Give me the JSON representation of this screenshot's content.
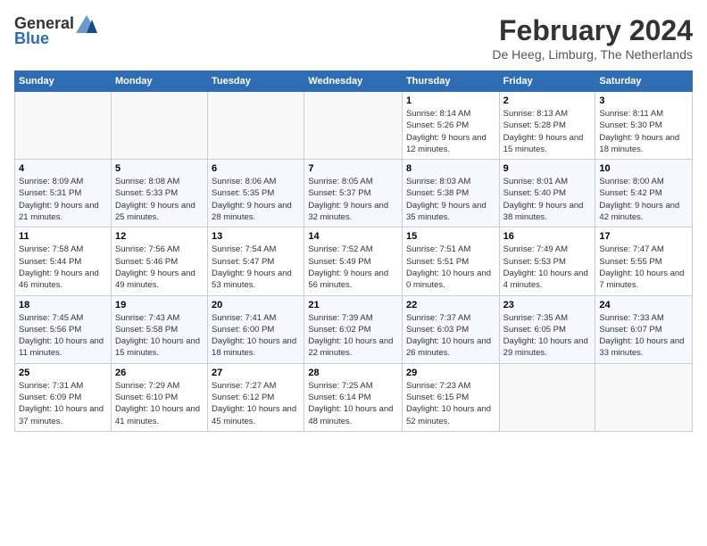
{
  "header": {
    "logo_general": "General",
    "logo_blue": "Blue",
    "month_year": "February 2024",
    "location": "De Heeg, Limburg, The Netherlands"
  },
  "calendar": {
    "days_of_week": [
      "Sunday",
      "Monday",
      "Tuesday",
      "Wednesday",
      "Thursday",
      "Friday",
      "Saturday"
    ],
    "weeks": [
      [
        {
          "day": "",
          "info": ""
        },
        {
          "day": "",
          "info": ""
        },
        {
          "day": "",
          "info": ""
        },
        {
          "day": "",
          "info": ""
        },
        {
          "day": "1",
          "info": "Sunrise: 8:14 AM\nSunset: 5:26 PM\nDaylight: 9 hours and 12 minutes."
        },
        {
          "day": "2",
          "info": "Sunrise: 8:13 AM\nSunset: 5:28 PM\nDaylight: 9 hours and 15 minutes."
        },
        {
          "day": "3",
          "info": "Sunrise: 8:11 AM\nSunset: 5:30 PM\nDaylight: 9 hours and 18 minutes."
        }
      ],
      [
        {
          "day": "4",
          "info": "Sunrise: 8:09 AM\nSunset: 5:31 PM\nDaylight: 9 hours and 21 minutes."
        },
        {
          "day": "5",
          "info": "Sunrise: 8:08 AM\nSunset: 5:33 PM\nDaylight: 9 hours and 25 minutes."
        },
        {
          "day": "6",
          "info": "Sunrise: 8:06 AM\nSunset: 5:35 PM\nDaylight: 9 hours and 28 minutes."
        },
        {
          "day": "7",
          "info": "Sunrise: 8:05 AM\nSunset: 5:37 PM\nDaylight: 9 hours and 32 minutes."
        },
        {
          "day": "8",
          "info": "Sunrise: 8:03 AM\nSunset: 5:38 PM\nDaylight: 9 hours and 35 minutes."
        },
        {
          "day": "9",
          "info": "Sunrise: 8:01 AM\nSunset: 5:40 PM\nDaylight: 9 hours and 38 minutes."
        },
        {
          "day": "10",
          "info": "Sunrise: 8:00 AM\nSunset: 5:42 PM\nDaylight: 9 hours and 42 minutes."
        }
      ],
      [
        {
          "day": "11",
          "info": "Sunrise: 7:58 AM\nSunset: 5:44 PM\nDaylight: 9 hours and 46 minutes."
        },
        {
          "day": "12",
          "info": "Sunrise: 7:56 AM\nSunset: 5:46 PM\nDaylight: 9 hours and 49 minutes."
        },
        {
          "day": "13",
          "info": "Sunrise: 7:54 AM\nSunset: 5:47 PM\nDaylight: 9 hours and 53 minutes."
        },
        {
          "day": "14",
          "info": "Sunrise: 7:52 AM\nSunset: 5:49 PM\nDaylight: 9 hours and 56 minutes."
        },
        {
          "day": "15",
          "info": "Sunrise: 7:51 AM\nSunset: 5:51 PM\nDaylight: 10 hours and 0 minutes."
        },
        {
          "day": "16",
          "info": "Sunrise: 7:49 AM\nSunset: 5:53 PM\nDaylight: 10 hours and 4 minutes."
        },
        {
          "day": "17",
          "info": "Sunrise: 7:47 AM\nSunset: 5:55 PM\nDaylight: 10 hours and 7 minutes."
        }
      ],
      [
        {
          "day": "18",
          "info": "Sunrise: 7:45 AM\nSunset: 5:56 PM\nDaylight: 10 hours and 11 minutes."
        },
        {
          "day": "19",
          "info": "Sunrise: 7:43 AM\nSunset: 5:58 PM\nDaylight: 10 hours and 15 minutes."
        },
        {
          "day": "20",
          "info": "Sunrise: 7:41 AM\nSunset: 6:00 PM\nDaylight: 10 hours and 18 minutes."
        },
        {
          "day": "21",
          "info": "Sunrise: 7:39 AM\nSunset: 6:02 PM\nDaylight: 10 hours and 22 minutes."
        },
        {
          "day": "22",
          "info": "Sunrise: 7:37 AM\nSunset: 6:03 PM\nDaylight: 10 hours and 26 minutes."
        },
        {
          "day": "23",
          "info": "Sunrise: 7:35 AM\nSunset: 6:05 PM\nDaylight: 10 hours and 29 minutes."
        },
        {
          "day": "24",
          "info": "Sunrise: 7:33 AM\nSunset: 6:07 PM\nDaylight: 10 hours and 33 minutes."
        }
      ],
      [
        {
          "day": "25",
          "info": "Sunrise: 7:31 AM\nSunset: 6:09 PM\nDaylight: 10 hours and 37 minutes."
        },
        {
          "day": "26",
          "info": "Sunrise: 7:29 AM\nSunset: 6:10 PM\nDaylight: 10 hours and 41 minutes."
        },
        {
          "day": "27",
          "info": "Sunrise: 7:27 AM\nSunset: 6:12 PM\nDaylight: 10 hours and 45 minutes."
        },
        {
          "day": "28",
          "info": "Sunrise: 7:25 AM\nSunset: 6:14 PM\nDaylight: 10 hours and 48 minutes."
        },
        {
          "day": "29",
          "info": "Sunrise: 7:23 AM\nSunset: 6:15 PM\nDaylight: 10 hours and 52 minutes."
        },
        {
          "day": "",
          "info": ""
        },
        {
          "day": "",
          "info": ""
        }
      ]
    ]
  }
}
